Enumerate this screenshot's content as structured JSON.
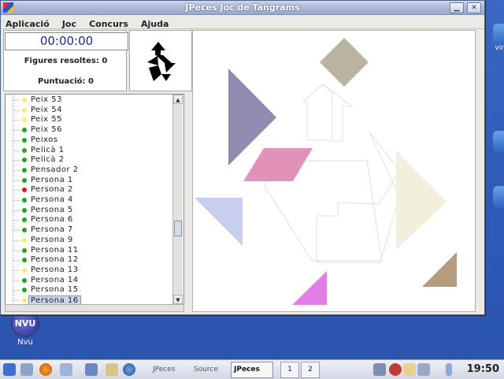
{
  "window": {
    "title": "JPeces    Joc de Tangrams",
    "menu": [
      "Aplicació",
      "Joc",
      "Concurs",
      "Ajuda"
    ]
  },
  "info": {
    "timer": "00:00:00",
    "solved": "Figures resoltes: 0",
    "score": "Puntuació:  0"
  },
  "tree": [
    {
      "label": "Peix  53",
      "status": "yellow"
    },
    {
      "label": "Peix  54",
      "status": "yellow"
    },
    {
      "label": "Peix  55",
      "status": "yellow"
    },
    {
      "label": "Peix  56",
      "status": "green"
    },
    {
      "label": "Peixos",
      "status": "green"
    },
    {
      "label": "Pelicà  1",
      "status": "green"
    },
    {
      "label": "Pelicà  2",
      "status": "green"
    },
    {
      "label": "Pensador  2",
      "status": "green"
    },
    {
      "label": "Persona  1",
      "status": "green"
    },
    {
      "label": "Persona  2",
      "status": "red"
    },
    {
      "label": "Persona  4",
      "status": "green"
    },
    {
      "label": "Persona  5",
      "status": "green"
    },
    {
      "label": "Persona  6",
      "status": "green"
    },
    {
      "label": "Persona  7",
      "status": "green"
    },
    {
      "label": "Persona  9",
      "status": "yellow"
    },
    {
      "label": "Persona  11",
      "status": "green"
    },
    {
      "label": "Persona  12",
      "status": "green"
    },
    {
      "label": "Persona  13",
      "status": "yellow"
    },
    {
      "label": "Persona  14",
      "status": "green"
    },
    {
      "label": "Persona  15",
      "status": "green"
    },
    {
      "label": "Persona  16",
      "status": "yellow",
      "selected": true
    }
  ],
  "colors": {
    "green": "#1fa51f",
    "yellow": "#f4ee6a",
    "red": "#d42020",
    "piece_square": "#b8b4a0",
    "piece_large_tri": "#8f8ab0",
    "piece_parallelogram": "#e291b8",
    "piece_small_tri_blue": "#c8cfee",
    "piece_cream_tri": "#f3efde",
    "piece_brown_tri": "#b49d7e",
    "piece_magenta_tri": "#e080e6"
  },
  "desktop": {
    "nvu_label": "Nvu",
    "nvu_badge": "NVU",
    "right_label": "vir"
  },
  "taskbar": {
    "tasks": [
      "JPeces",
      "Source",
      "JPeces"
    ],
    "pager": [
      "1",
      "2"
    ],
    "clock": "19:50"
  }
}
